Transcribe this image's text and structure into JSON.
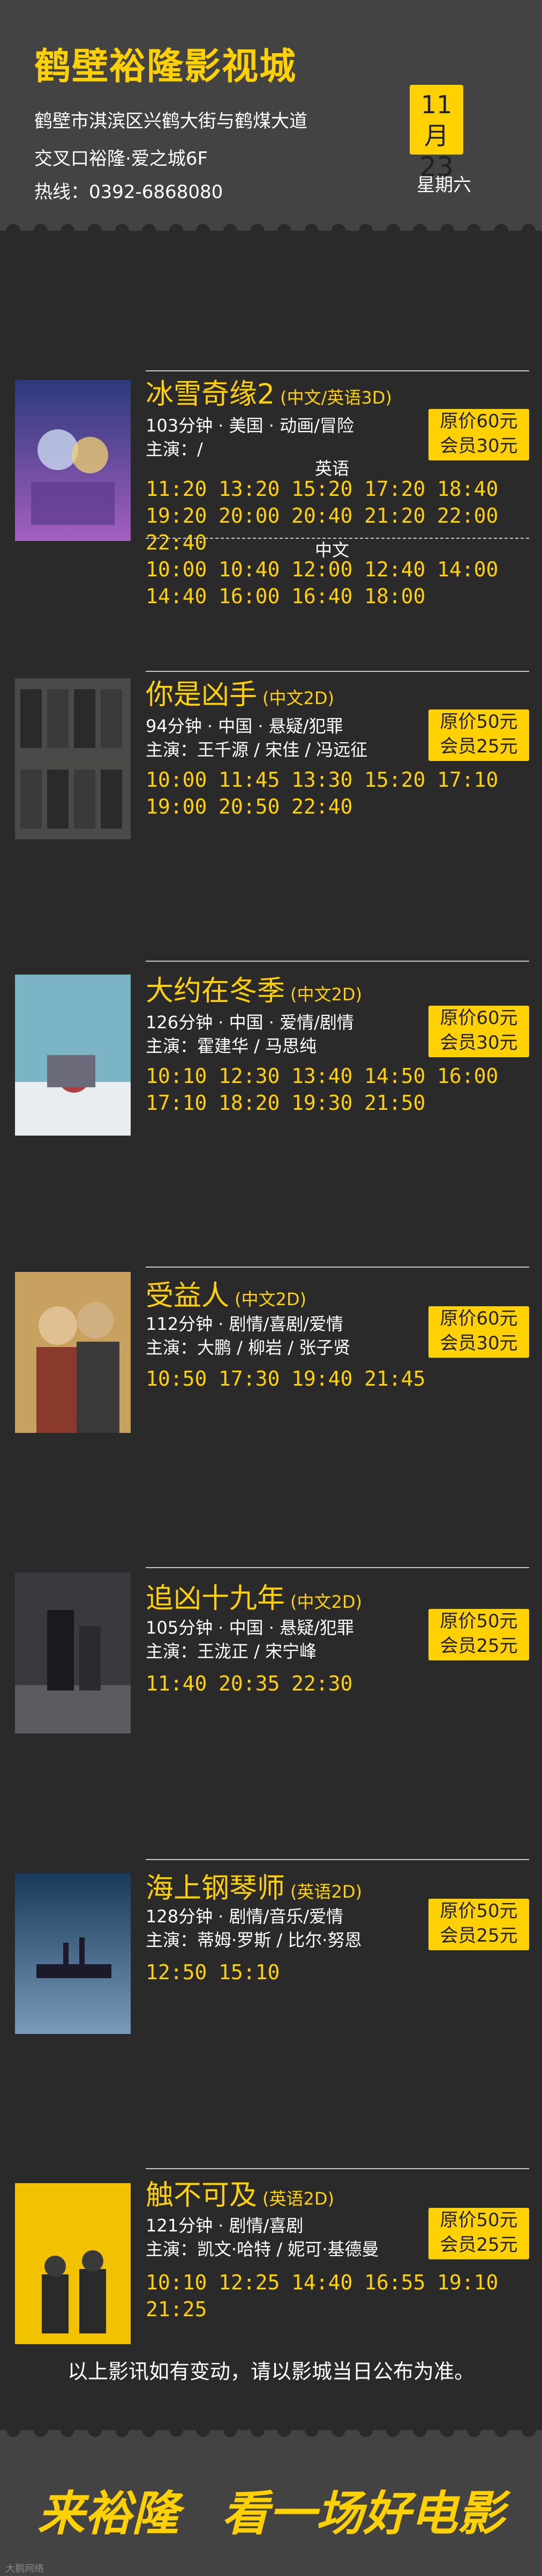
{
  "cinema": {
    "name": "鹤壁裕隆影视城",
    "address_line1": "鹤壁市淇滨区兴鹤大街与鹤煤大道",
    "address_line2": "交叉口裕隆·爱之城6F",
    "hotline": "热线：0392-6868080",
    "date_month": "11月",
    "date_day": "23",
    "weekday": "星期六"
  },
  "movies": [
    {
      "title": "冰雪奇缘2",
      "format": "(中文/英语3D)",
      "meta": "103分钟 · 美国 · 动画/冒险",
      "cast": "主演：/",
      "price": "原价60元",
      "member": "会员30元",
      "lang_a": "英语",
      "lang_b": "中文",
      "times_a": [
        "11:20",
        "13:20",
        "15:20",
        "17:20",
        "18:40",
        "19:20",
        "20:00",
        "20:40",
        "21:20",
        "22:00",
        "22:40"
      ],
      "times_b": [
        "10:00",
        "10:40",
        "12:00",
        "12:40",
        "14:00",
        "14:40",
        "16:00",
        "16:40",
        "18:00"
      ],
      "poster_text": "冰雪奇缘2"
    },
    {
      "title": "你是凶手",
      "format": "(中文2D)",
      "meta": "94分钟 · 中国 · 悬疑/犯罪",
      "cast": "主演：王千源 / 宋佳 / 冯远征",
      "price": "原价50元",
      "member": "会员25元",
      "times": [
        "10:00",
        "11:45",
        "13:30",
        "15:20",
        "17:10",
        "19:00",
        "20:50",
        "22:40"
      ],
      "poster_text": "你是凶手"
    },
    {
      "title": "大约在冬季",
      "format": "(中文2D)",
      "meta": "126分钟 · 中国 · 爱情/剧情",
      "cast": "主演：霍建华 / 马思纯",
      "price": "原价60元",
      "member": "会员30元",
      "times": [
        "10:10",
        "12:30",
        "13:40",
        "14:50",
        "16:00",
        "17:10",
        "18:20",
        "19:30",
        "21:50"
      ],
      "poster_text": "大约在冬季"
    },
    {
      "title": "受益人",
      "format": "(中文2D)",
      "meta": "112分钟 · 剧情/喜剧/爱情",
      "cast": "主演：大鹏 / 柳岩 / 张子贤",
      "price": "原价60元",
      "member": "会员30元",
      "times": [
        "10:50",
        "17:30",
        "19:40",
        "21:45"
      ],
      "poster_text": "受益人"
    },
    {
      "title": "追凶十九年",
      "format": "(中文2D)",
      "meta": "105分钟 · 中国 · 悬疑/犯罪",
      "cast": "主演：王泷正 / 宋宁峰",
      "price": "原价50元",
      "member": "会员25元",
      "times": [
        "11:40",
        "20:35",
        "22:30"
      ],
      "poster_text": "追凶十九年"
    },
    {
      "title": "海上钢琴师",
      "format": "(英语2D)",
      "meta": "128分钟 · 剧情/音乐/爱情",
      "cast": "主演：蒂姆·罗斯 / 比尔·努恩",
      "price": "原价50元",
      "member": "会员25元",
      "times": [
        "12:50",
        "15:10"
      ],
      "poster_text": "海上钢琴师"
    },
    {
      "title": "触不可及",
      "format": "(英语2D)",
      "meta": "121分钟 · 剧情/喜剧",
      "cast": "主演：凯文·哈特 / 妮可·基德曼",
      "price": "原价50元",
      "member": "会员25元",
      "times": [
        "10:10",
        "12:25",
        "14:40",
        "16:55",
        "19:10",
        "21:25"
      ],
      "poster_text": "触不可及"
    }
  ],
  "footer": {
    "note": "以上影讯如有变动，请以影城当日公布为准。",
    "slogan_a": "来裕隆",
    "slogan_b": "看一场好电影",
    "watermark": "大鹅网络"
  },
  "colors": {
    "accent": "#ffd100",
    "background": "#2a2a2a",
    "panel": "#434343"
  }
}
